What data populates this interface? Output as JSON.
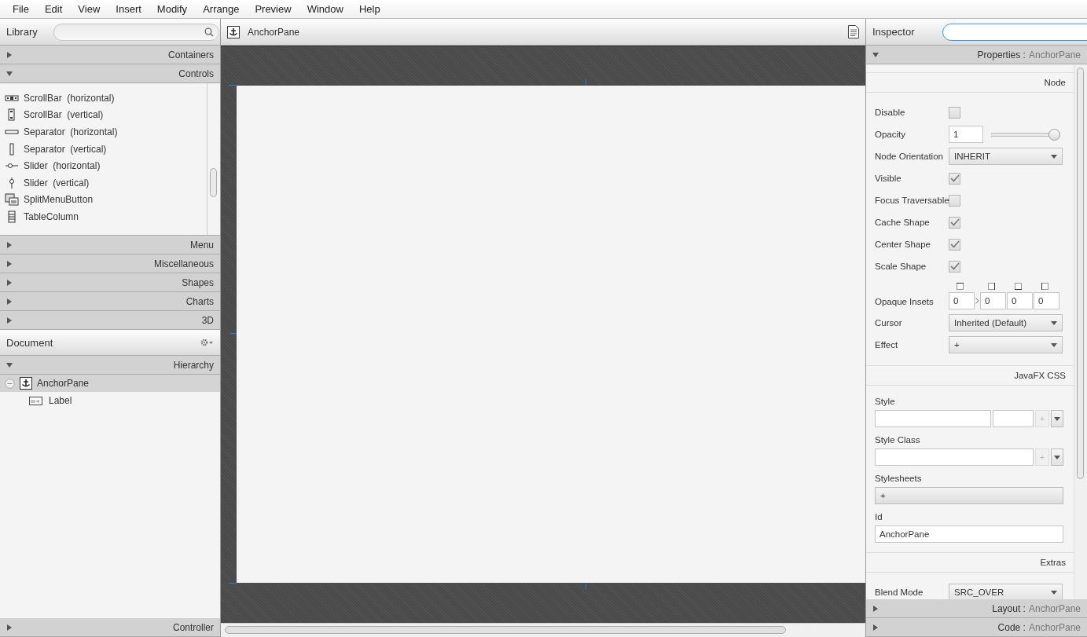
{
  "menu": [
    {
      "label": "File"
    },
    {
      "label": "Edit"
    },
    {
      "label": "View"
    },
    {
      "label": "Insert"
    },
    {
      "label": "Modify"
    },
    {
      "label": "Arrange"
    },
    {
      "label": "Preview"
    },
    {
      "label": "Window"
    },
    {
      "label": "Help"
    }
  ],
  "library": {
    "title": "Library",
    "sections": [
      {
        "label": "Containers",
        "expanded": false
      },
      {
        "label": "Controls",
        "expanded": true,
        "items": [
          {
            "label": "ScrollBar  (horizontal)"
          },
          {
            "label": "ScrollBar  (vertical)"
          },
          {
            "label": "Separator  (horizontal)"
          },
          {
            "label": "Separator  (vertical)"
          },
          {
            "label": "Slider  (horizontal)"
          },
          {
            "label": "Slider  (vertical)"
          },
          {
            "label": "SplitMenuButton"
          },
          {
            "label": "TableColumn"
          }
        ]
      },
      {
        "label": "Menu",
        "expanded": false
      },
      {
        "label": "Miscellaneous",
        "expanded": false
      },
      {
        "label": "Shapes",
        "expanded": false
      },
      {
        "label": "Charts",
        "expanded": false
      },
      {
        "label": "3D",
        "expanded": false
      }
    ]
  },
  "document": {
    "title": "Document",
    "sections": [
      {
        "label": "Hierarchy",
        "expanded": true,
        "tree": [
          {
            "label": "AnchorPane",
            "selected": true,
            "expanded": true,
            "children": [
              {
                "label": "Label",
                "selected": false
              }
            ]
          }
        ]
      },
      {
        "label": "Controller",
        "expanded": false
      }
    ]
  },
  "canvas": {
    "title": "AnchorPane"
  },
  "inspector": {
    "title": "Inspector",
    "sections": [
      {
        "label": "Properties :",
        "subject": "AnchorPane",
        "expanded": true,
        "groups": [
          {
            "title": "Node",
            "rows": [
              {
                "kind": "checkbox",
                "label": "Disable",
                "checked": false
              },
              {
                "kind": "slider",
                "label": "Opacity",
                "value": "1",
                "level": 1
              },
              {
                "kind": "select",
                "label": "Node Orientation",
                "value": "INHERIT"
              },
              {
                "kind": "checkbox",
                "label": "Visible",
                "checked": true
              },
              {
                "kind": "checkbox",
                "label": "Focus Traversable",
                "checked": false
              },
              {
                "kind": "checkbox",
                "label": "Cache Shape",
                "checked": true
              },
              {
                "kind": "checkbox",
                "label": "Center Shape",
                "checked": true
              },
              {
                "kind": "checkbox",
                "label": "Scale Shape",
                "checked": true
              },
              {
                "kind": "insets",
                "label": "Opaque Insets",
                "values": [
                  "0",
                  "0",
                  "0",
                  "0"
                ]
              },
              {
                "kind": "select",
                "label": "Cursor",
                "value": "Inherited (Default)"
              },
              {
                "kind": "select",
                "label": "Effect",
                "value": "+"
              }
            ]
          },
          {
            "title": "JavaFX CSS",
            "rows": [
              {
                "kind": "style",
                "label": "Style",
                "add": "+"
              },
              {
                "kind": "style-class",
                "label": "Style Class",
                "add": "+"
              },
              {
                "kind": "button",
                "label": "Stylesheets",
                "button": "+"
              },
              {
                "kind": "text",
                "label": "Id",
                "value": "AnchorPane"
              }
            ]
          },
          {
            "title": "Extras",
            "rows": [
              {
                "kind": "select",
                "label": "Blend Mode",
                "value": "SRC_OVER"
              }
            ]
          }
        ]
      },
      {
        "label": "Layout :",
        "subject": "AnchorPane",
        "expanded": false
      },
      {
        "label": "Code :",
        "subject": "AnchorPane",
        "expanded": false
      }
    ]
  }
}
